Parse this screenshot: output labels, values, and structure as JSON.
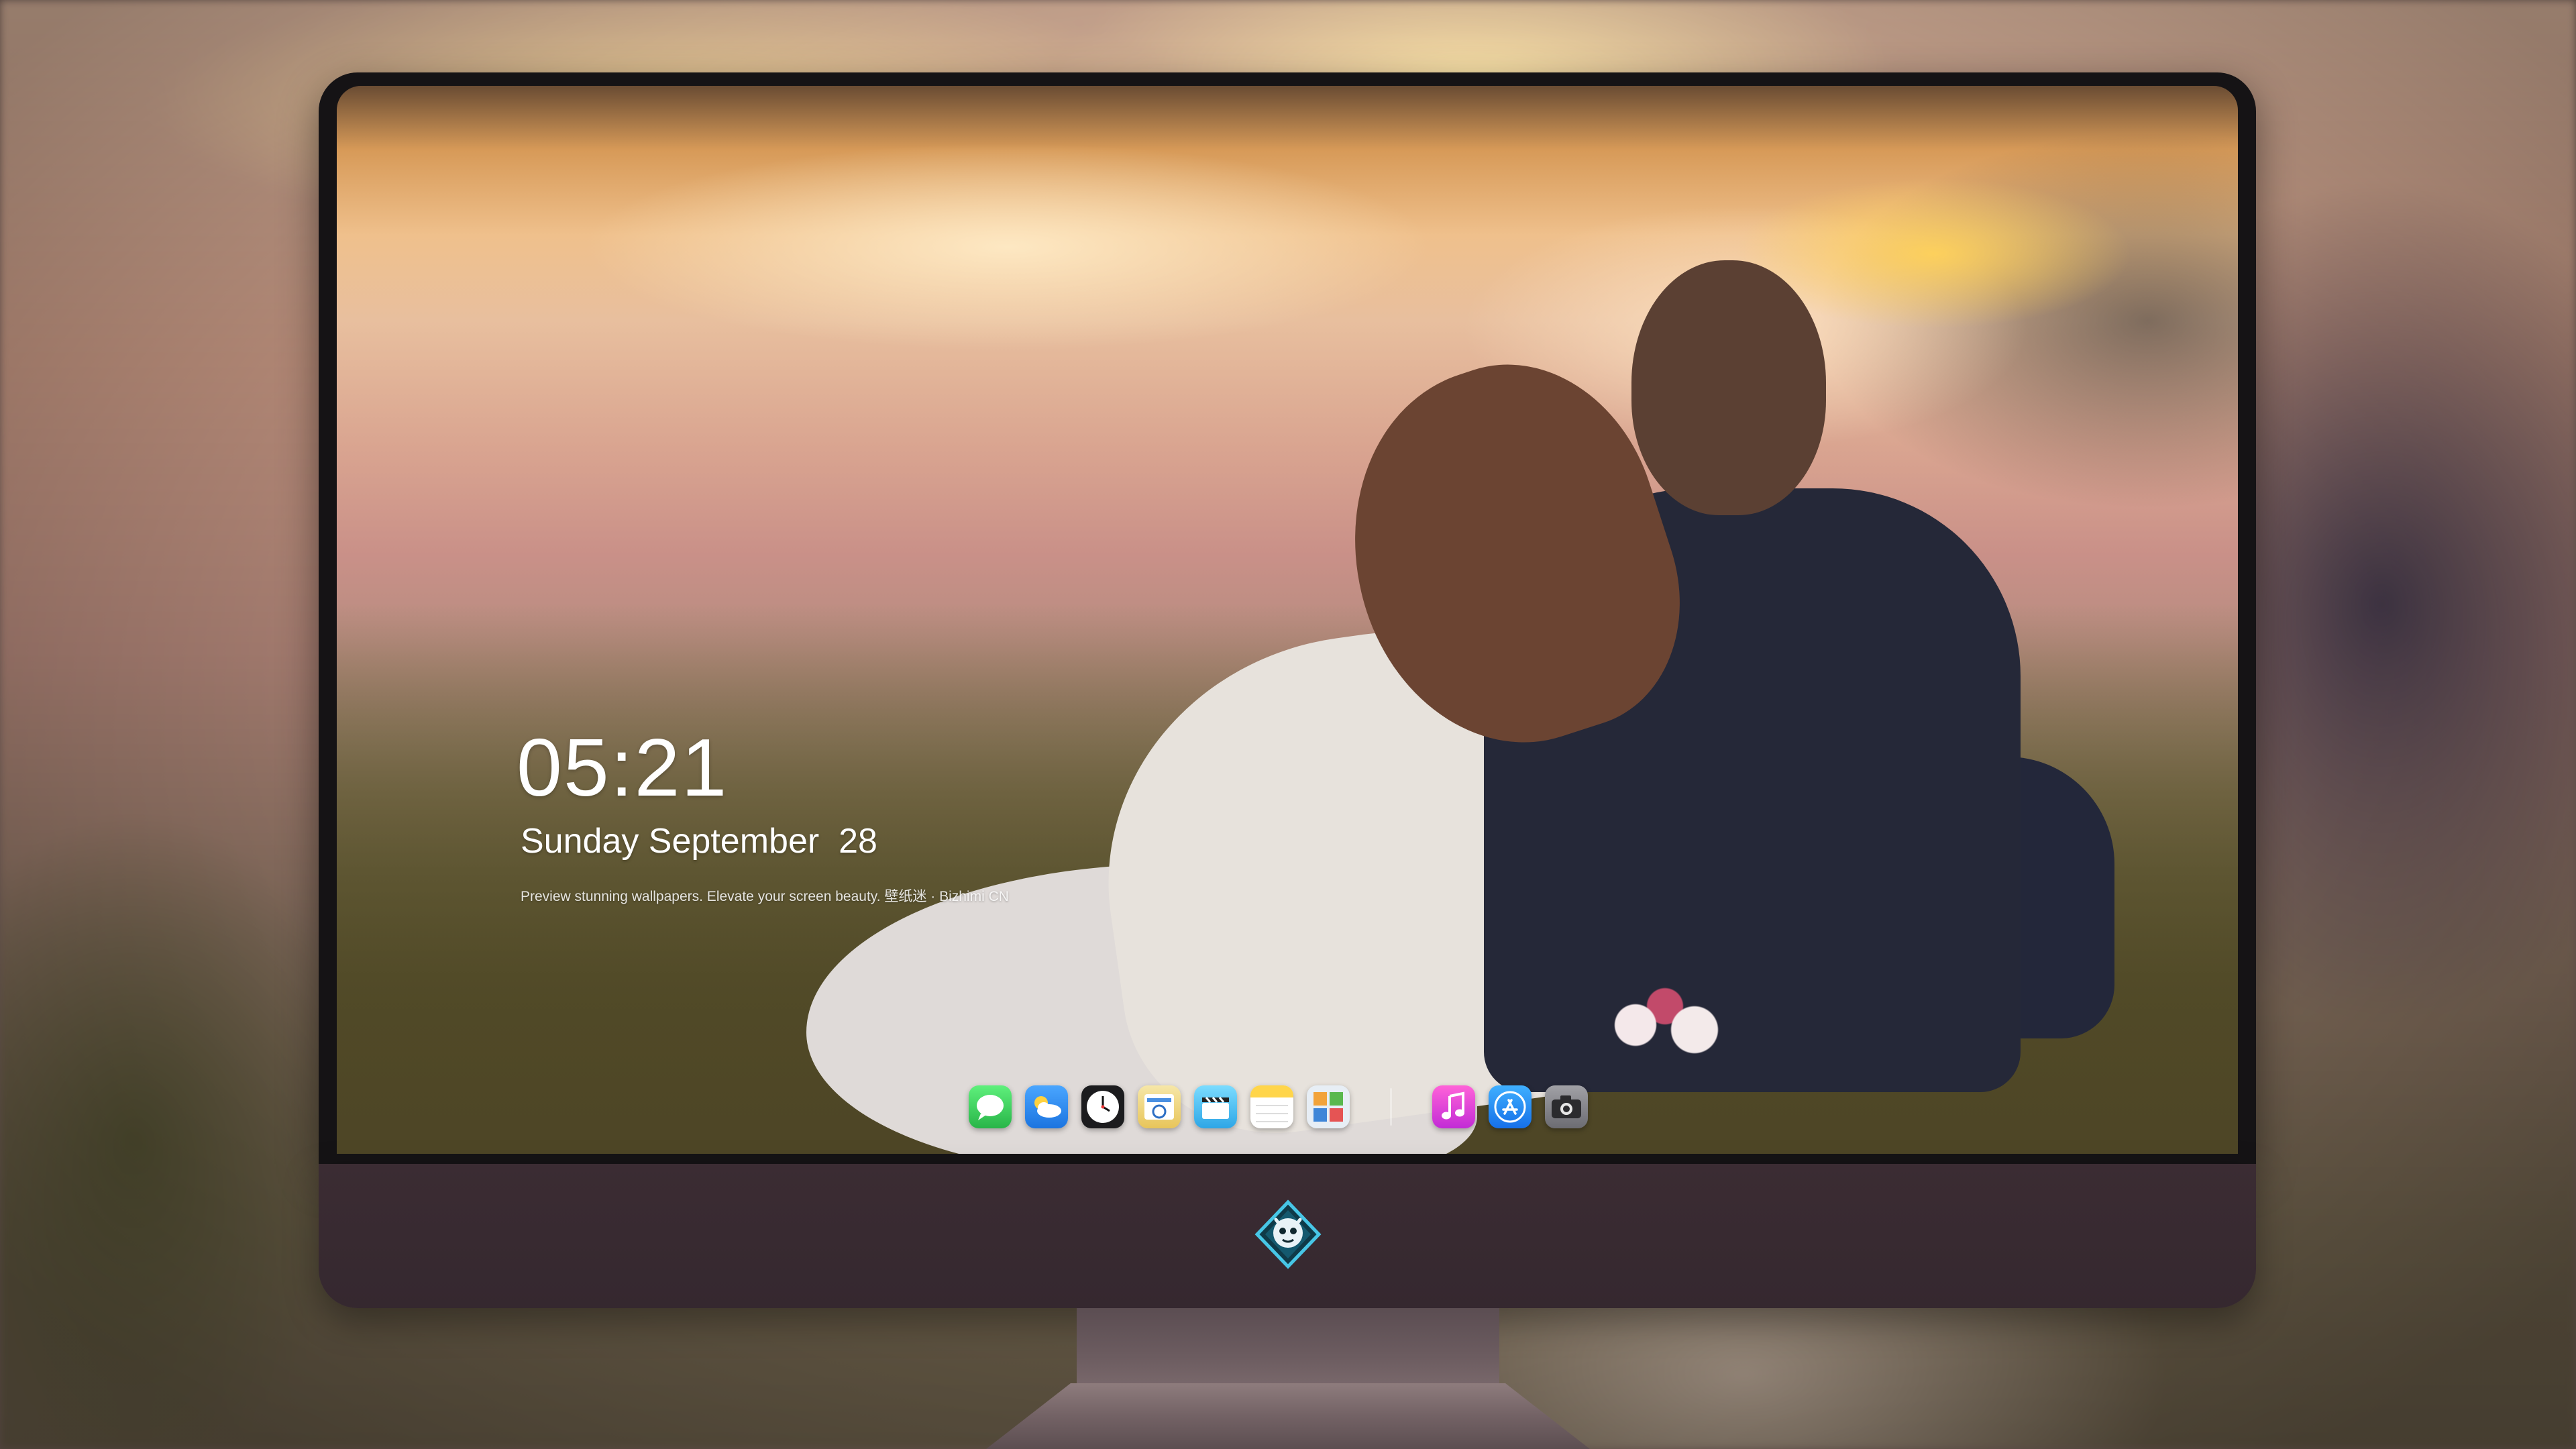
{
  "lock_screen": {
    "time": "05:21",
    "date": "Sunday September  28",
    "tagline": "Preview stunning wallpapers. Elevate your screen beauty. 壁纸迷 · Bizhimi CN"
  },
  "dock": {
    "apps": [
      {
        "name": "Messages",
        "icon": "messages-icon",
        "color": "#34c759"
      },
      {
        "name": "Weather",
        "icon": "weather-icon",
        "color": "#2f8ff5"
      },
      {
        "name": "Clock",
        "icon": "clock-icon",
        "color": "#1c1c1e"
      },
      {
        "name": "Preview",
        "icon": "preview-icon",
        "color": "#f2d36b"
      },
      {
        "name": "Clips",
        "icon": "clapperboard-icon",
        "color": "#5ac8fa"
      },
      {
        "name": "Notes",
        "icon": "notes-icon",
        "color": "#ffd54a"
      },
      {
        "name": "Photo Booth",
        "icon": "gallery-icon",
        "color": "#d8e4ef"
      },
      {
        "name": "Music",
        "icon": "music-icon",
        "color": "#e33bd0"
      },
      {
        "name": "App Store",
        "icon": "app-store-icon",
        "color": "#1b8cf5"
      },
      {
        "name": "Camera",
        "icon": "camera-icon",
        "color": "#8e8e93"
      }
    ]
  },
  "monitor": {
    "logo": "dragon-mascot-logo",
    "bezel_color": "#151315",
    "chin_color": "#3b2c33"
  }
}
